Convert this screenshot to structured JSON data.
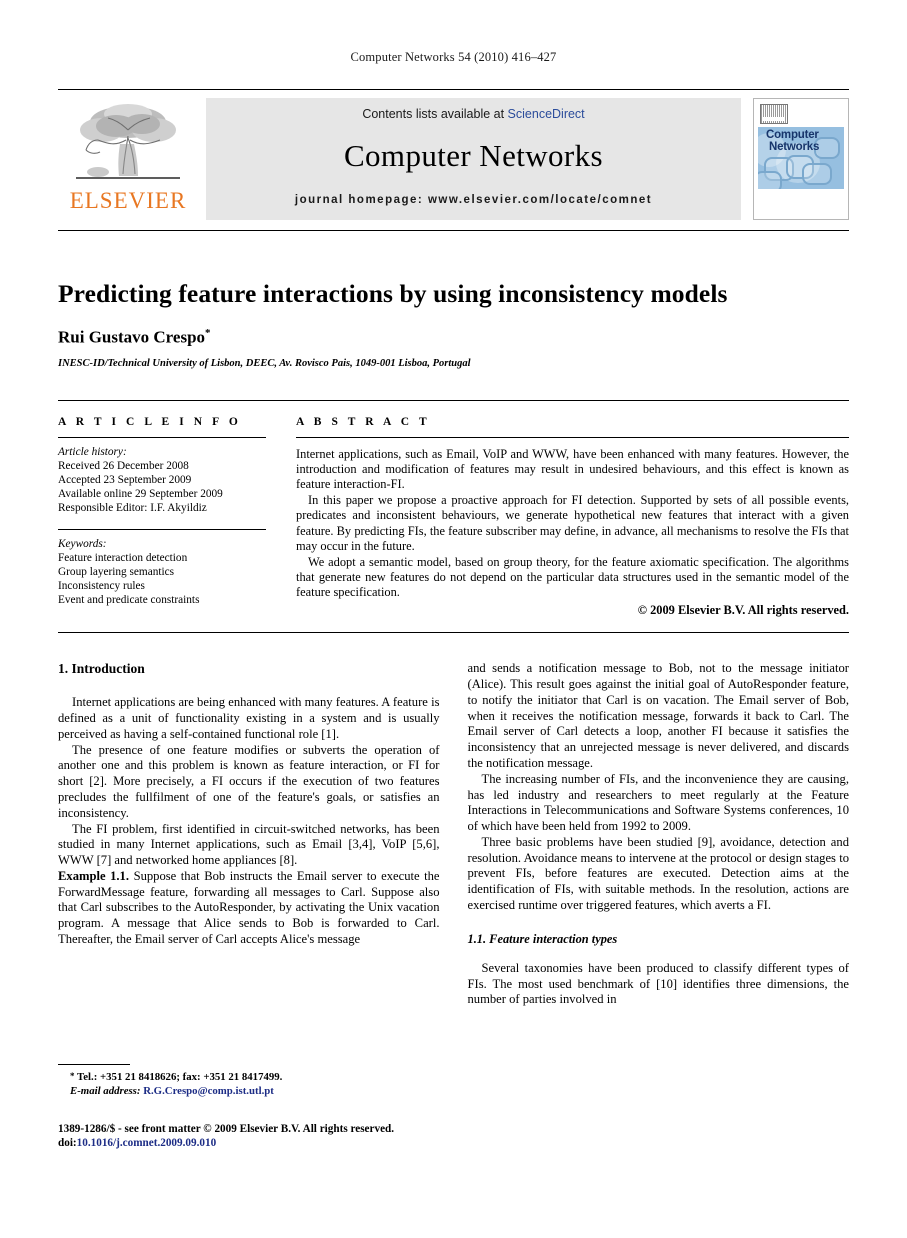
{
  "running_head": "Computer Networks 54 (2010) 416–427",
  "masthead": {
    "publisher_name": "ELSEVIER",
    "contents_prefix": "Contents lists available at ",
    "sciencedirect": "ScienceDirect",
    "journal_title": "Computer Networks",
    "homepage": "journal homepage: www.elsevier.com/locate/comnet",
    "cover_title_line1": "Computer",
    "cover_title_line2": "Networks",
    "link_color": "#2b4c9b"
  },
  "article": {
    "title": "Predicting feature interactions by using inconsistency models",
    "author": "Rui Gustavo Crespo",
    "author_marker": "*",
    "affiliation": "INESC-ID/Technical University of Lisbon, DEEC, Av. Rovisco Pais, 1049-001 Lisboa, Portugal"
  },
  "info": {
    "heading": "A R T I C L E    I N F O",
    "history_title": "Article history:",
    "history": [
      "Received 26 December 2008",
      "Accepted 23 September 2009",
      "Available online 29 September 2009",
      "Responsible Editor: I.F. Akyildiz"
    ],
    "keywords_title": "Keywords:",
    "keywords": [
      "Feature interaction detection",
      "Group layering semantics",
      "Inconsistency rules",
      "Event and predicate constraints"
    ]
  },
  "abstract": {
    "heading": "A B S T R A C T",
    "paragraphs": [
      "Internet applications, such as Email, VoIP and WWW, have been enhanced with many features. However, the introduction and modification of features may result in undesired behaviours, and this effect is known as feature interaction-FI.",
      "In this paper we propose a proactive approach for FI detection. Supported by sets of all possible events, predicates and inconsistent behaviours, we generate hypothetical new features that interact with a given feature. By predicting FIs, the feature subscriber may define, in advance, all mechanisms to resolve the FIs that may occur in the future.",
      "We adopt a semantic model, based on group theory, for the feature axiomatic specification. The algorithms that generate new features do not depend on the particular data structures used in the semantic model of the feature specification."
    ],
    "copyright": "© 2009 Elsevier B.V. All rights reserved."
  },
  "body": {
    "section1_title": "1. Introduction",
    "left_paragraphs": [
      "Internet applications are being enhanced with many features. A feature is defined as a unit of functionality existing in a system and is usually perceived as having a self-contained functional role [1].",
      "The presence of one feature modifies or subverts the operation of another one and this problem is known as feature interaction, or FI for short [2]. More precisely, a FI occurs if the execution of two features precludes the fullfilment of one of the feature's goals, or satisfies an inconsistency.",
      "The FI problem, first identified in circuit-switched networks, has been studied in many Internet applications, such as Email [3,4], VoIP [5,6], WWW [7] and networked home appliances [8]."
    ],
    "example_label": "Example 1.1.",
    "example_text": "Suppose that Bob instructs the Email server to execute the ForwardMessage feature, forwarding all messages to Carl. Suppose also that Carl subscribes to the AutoResponder, by activating the Unix vacation program. A message that Alice sends to Bob is forwarded to Carl. Thereafter, the Email server of Carl accepts Alice's message",
    "right_paragraphs": [
      "and sends a notification message to Bob, not to the message initiator (Alice). This result goes against the initial goal of AutoResponder feature, to notify the initiator that Carl is on vacation. The Email server of Bob, when it receives the notification message, forwards it back to Carl. The Email server of Carl detects a loop, another FI because it satisfies the inconsistency that an unrejected message is never delivered, and discards the notification message.",
      "The increasing number of FIs, and the inconvenience they are causing, has led industry and researchers to meet regularly at the Feature Interactions in Telecommunications and Software Systems conferences, 10 of which have been held from 1992 to 2009.",
      "Three basic problems have been studied [9], avoidance, detection and resolution. Avoidance means to intervene at the protocol or design stages to prevent FIs, before features are executed. Detection aims at the identification of FIs, with suitable methods. In the resolution, actions are exercised runtime over triggered features, which averts a FI."
    ],
    "subsection_title": "1.1. Feature interaction types",
    "right_last_paragraph": "Several taxonomies have been produced to classify different types of FIs. The most used benchmark of [10] identifies three dimensions, the number of parties involved in"
  },
  "footnote": {
    "marker": "*",
    "contact": "Tel.: +351 21 8418626; fax: +351 21 8417499.",
    "email_label": "E-mail address:",
    "email": "R.G.Crespo@comp.ist.utl.pt"
  },
  "imprint": {
    "line1": "1389-1286/$ - see front matter © 2009 Elsevier B.V. All rights reserved.",
    "doi_label": "doi:",
    "doi": "10.1016/j.comnet.2009.09.010"
  }
}
